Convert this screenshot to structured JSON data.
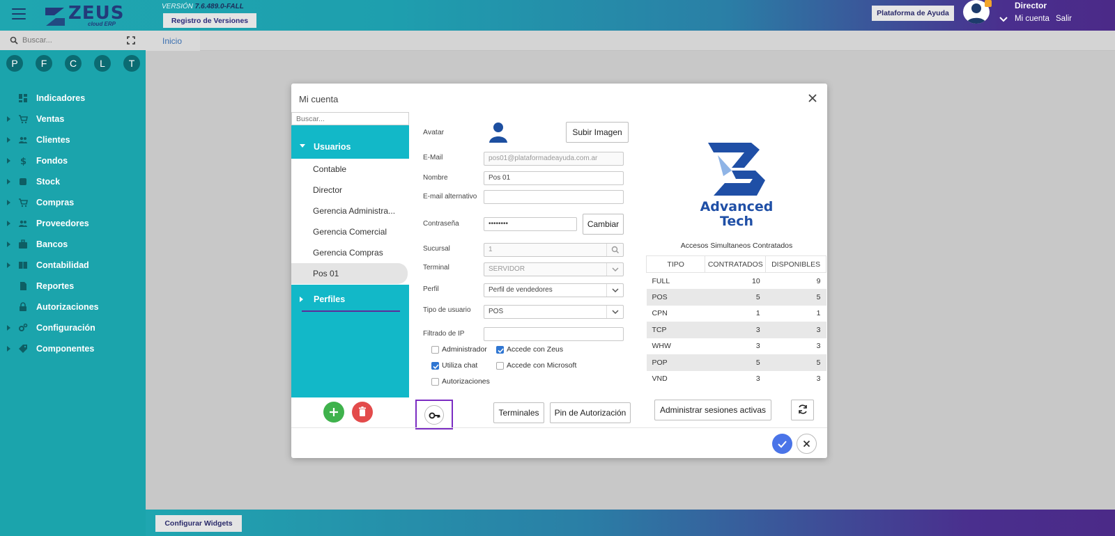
{
  "header": {
    "logo_text": "ZEUS",
    "logo_sub": "cloud ERP",
    "version_prefix": "VERSIÓN",
    "version_number": "7.6.489.0-FALL",
    "release_notes_button": "Registro de Versiones",
    "help_button": "Plataforma de Ayuda",
    "user_role": "Director",
    "account_link": "Mi cuenta",
    "logout_link": "Salir"
  },
  "sidebar": {
    "search_placeholder": "Buscar...",
    "shortcuts": [
      "P",
      "F",
      "C",
      "L",
      "T"
    ],
    "items": [
      {
        "label": "Indicadores",
        "icon": "dashboard-icon",
        "expandable": false
      },
      {
        "label": "Ventas",
        "icon": "cart-icon",
        "expandable": true
      },
      {
        "label": "Clientes",
        "icon": "people-icon",
        "expandable": true
      },
      {
        "label": "Fondos",
        "icon": "dollar-icon",
        "expandable": true
      },
      {
        "label": "Stock",
        "icon": "stock-icon",
        "expandable": true
      },
      {
        "label": "Compras",
        "icon": "shopping-cart-plus-icon",
        "expandable": true
      },
      {
        "label": "Proveedores",
        "icon": "suppliers-icon",
        "expandable": true
      },
      {
        "label": "Bancos",
        "icon": "briefcase-icon",
        "expandable": true
      },
      {
        "label": "Contabilidad",
        "icon": "book-icon",
        "expandable": true
      },
      {
        "label": "Reportes",
        "icon": "report-icon",
        "expandable": false
      },
      {
        "label": "Autorizaciones",
        "icon": "lock-icon",
        "expandable": false
      },
      {
        "label": "Configuración",
        "icon": "gears-icon",
        "expandable": true
      },
      {
        "label": "Componentes",
        "icon": "tag-icon",
        "expandable": true
      }
    ]
  },
  "main": {
    "tab_home": "Inicio",
    "configure_widgets_button": "Configurar Widgets"
  },
  "modal": {
    "title": "Mi cuenta",
    "users_search_placeholder": "Buscar...",
    "group_users": "Usuarios",
    "group_profiles": "Perfiles",
    "users": [
      "Contable",
      "Director",
      "Gerencia Administra...",
      "Gerencia Comercial",
      "Gerencia Compras",
      "Pos 01"
    ],
    "selected_user": "Pos 01",
    "form": {
      "avatar_label": "Avatar",
      "upload_button": "Subir Imagen",
      "email_label": "E-Mail",
      "email_value": "pos01@plataformadeayuda.com.ar",
      "name_label": "Nombre",
      "name_value": "Pos 01",
      "alt_email_label": "E-mail alternativo",
      "alt_email_value": "",
      "password_label": "Contraseña",
      "password_value": "••••••••",
      "change_button": "Cambiar",
      "branch_label": "Sucursal",
      "branch_value": "1",
      "terminal_label": "Terminal",
      "terminal_value": "SERVIDOR",
      "profile_label": "Perfil",
      "profile_value": "Perfil de vendedores",
      "user_type_label": "Tipo de usuario",
      "user_type_value": "POS",
      "ip_filter_label": "Filtrado de IP",
      "ip_filter_value": "",
      "checkboxes": [
        {
          "label": "Administrador",
          "checked": false
        },
        {
          "label": "Accede con Zeus",
          "checked": true
        },
        {
          "label": "Utiliza chat",
          "checked": true
        },
        {
          "label": "Accede con Microsoft",
          "checked": false
        },
        {
          "label": "Autorizaciones",
          "checked": false
        }
      ],
      "terminals_button": "Terminales",
      "pin_button": "Pin de Autorización"
    },
    "license": {
      "brand_line1": "Advanced",
      "brand_line2": "Tech",
      "caption": "Accesos Simultaneos Contratados",
      "columns": [
        "TIPO",
        "CONTRATADOS",
        "DISPONIBLES"
      ],
      "rows": [
        [
          "FULL",
          "10",
          "9"
        ],
        [
          "POS",
          "5",
          "5"
        ],
        [
          "CPN",
          "1",
          "1"
        ],
        [
          "TCP",
          "3",
          "3"
        ],
        [
          "WHW",
          "3",
          "3"
        ],
        [
          "POP",
          "5",
          "5"
        ],
        [
          "VND",
          "3",
          "3"
        ]
      ],
      "sessions_button": "Administrar sesiones activas"
    }
  },
  "colors": {
    "sidebar_bg": "#1ba4ac",
    "panel_bg": "#12b8c8",
    "accent_purple": "#5b2c9a",
    "confirm_blue": "#4a74e8",
    "add_green": "#3fb24c",
    "delete_red": "#e34b4b",
    "brand_blue": "#1f4fa6"
  }
}
